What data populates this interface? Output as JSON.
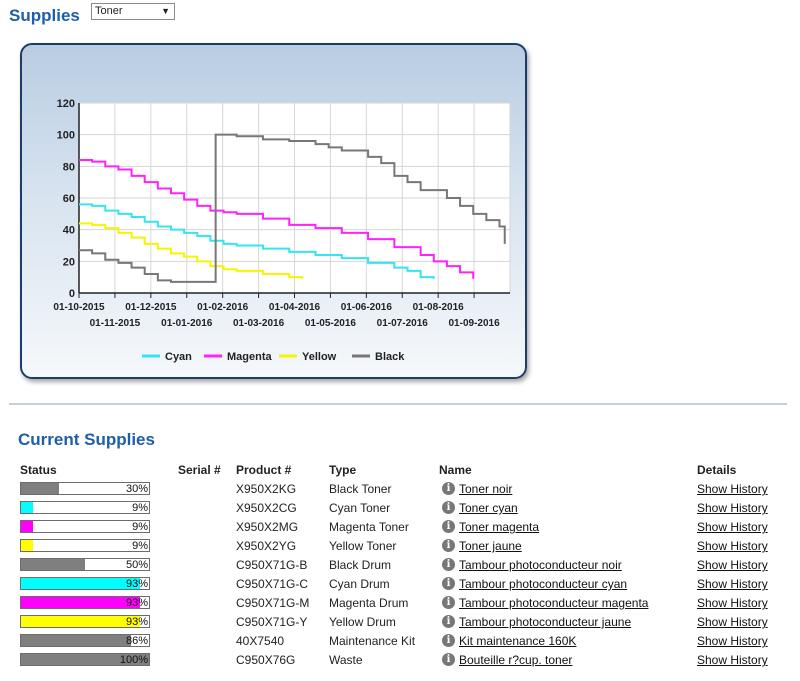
{
  "header": {
    "title": "Supplies",
    "select_value": "Toner"
  },
  "chart_data": {
    "type": "line",
    "x_ticks_top": [
      "01-10-2015",
      "01-12-2015",
      "01-02-2016",
      "01-04-2016",
      "01-06-2016",
      "01-08-2016"
    ],
    "x_ticks_bottom": [
      "01-11-2015",
      "01-01-2016",
      "01-03-2016",
      "01-05-2016",
      "01-07-2016",
      "01-09-2016"
    ],
    "ylim": [
      0,
      120
    ],
    "yticks": [
      "0",
      "20",
      "40",
      "60",
      "80",
      "100",
      "120"
    ],
    "grid": true,
    "legend_position": "bottom",
    "series": [
      {
        "name": "Cyan",
        "color": "#33e6ee",
        "points": [
          [
            0,
            56
          ],
          [
            0.5,
            55
          ],
          [
            1,
            52
          ],
          [
            1.5,
            50
          ],
          [
            2,
            48
          ],
          [
            2.5,
            45
          ],
          [
            3,
            42
          ],
          [
            3.5,
            40
          ],
          [
            4,
            38
          ],
          [
            4.5,
            36
          ],
          [
            5,
            33
          ],
          [
            5.5,
            31
          ],
          [
            6,
            30
          ],
          [
            7,
            28
          ],
          [
            8,
            26
          ],
          [
            9,
            24
          ],
          [
            10,
            22
          ],
          [
            11,
            19
          ],
          [
            12,
            16
          ],
          [
            12.5,
            14
          ],
          [
            13,
            10
          ],
          [
            13.5,
            9
          ]
        ]
      },
      {
        "name": "Magenta",
        "color": "#ff22ff",
        "points": [
          [
            0,
            84
          ],
          [
            0.5,
            83
          ],
          [
            1,
            80
          ],
          [
            1.5,
            78
          ],
          [
            2,
            74
          ],
          [
            2.5,
            70
          ],
          [
            3,
            66
          ],
          [
            3.5,
            63
          ],
          [
            4,
            59
          ],
          [
            4.5,
            55
          ],
          [
            5,
            52
          ],
          [
            5.5,
            51
          ],
          [
            6,
            50
          ],
          [
            7,
            47
          ],
          [
            8,
            43
          ],
          [
            9,
            41
          ],
          [
            10,
            38
          ],
          [
            11,
            34
          ],
          [
            12,
            29
          ],
          [
            13,
            24
          ],
          [
            13.5,
            20
          ],
          [
            14,
            17
          ],
          [
            14.5,
            13
          ],
          [
            15,
            9
          ]
        ]
      },
      {
        "name": "Yellow",
        "color": "#f5f500",
        "points": [
          [
            0,
            44
          ],
          [
            0.5,
            43
          ],
          [
            1,
            41
          ],
          [
            1.5,
            38
          ],
          [
            2,
            35
          ],
          [
            2.5,
            31
          ],
          [
            3,
            28
          ],
          [
            3.5,
            25
          ],
          [
            4,
            23
          ],
          [
            4.5,
            20
          ],
          [
            5,
            17
          ],
          [
            5.5,
            15
          ],
          [
            6,
            14
          ],
          [
            7,
            12
          ],
          [
            8,
            10
          ],
          [
            8.5,
            9
          ]
        ]
      },
      {
        "name": "Black",
        "color": "#777777",
        "points": [
          [
            0,
            27
          ],
          [
            0.5,
            25
          ],
          [
            1,
            21
          ],
          [
            1.5,
            19
          ],
          [
            2,
            16
          ],
          [
            2.5,
            12
          ],
          [
            3,
            8
          ],
          [
            3.5,
            7
          ],
          [
            4,
            7
          ],
          [
            5,
            7
          ],
          [
            5.2,
            100
          ],
          [
            6,
            99
          ],
          [
            7,
            97
          ],
          [
            8,
            96
          ],
          [
            9,
            94
          ],
          [
            9.5,
            92
          ],
          [
            10,
            90
          ],
          [
            11,
            86
          ],
          [
            11.5,
            82
          ],
          [
            12,
            74
          ],
          [
            12.5,
            70
          ],
          [
            13,
            65
          ],
          [
            14,
            60
          ],
          [
            14.5,
            55
          ],
          [
            15,
            50
          ],
          [
            15.5,
            46
          ],
          [
            16,
            42
          ],
          [
            16.2,
            31
          ]
        ]
      }
    ],
    "xlim": [
      0,
      16.4
    ]
  },
  "current": {
    "title": "Current Supplies",
    "headers": {
      "status": "Status",
      "serial": "Serial #",
      "product": "Product #",
      "type": "Type",
      "name": "Name",
      "details": "Details"
    },
    "rows": [
      {
        "pct": 30,
        "pct_label": "30%",
        "fill": "#7f7f7f",
        "product": "X950X2KG",
        "type": "Black Toner",
        "name": "Toner noir",
        "details": "Show History"
      },
      {
        "pct": 9,
        "pct_label": "9%",
        "fill": "#00ffff",
        "product": "X950X2CG",
        "type": "Cyan Toner",
        "name": "Toner cyan",
        "details": "Show History"
      },
      {
        "pct": 9,
        "pct_label": "9%",
        "fill": "#ff00ff",
        "product": "X950X2MG",
        "type": "Magenta Toner",
        "name": "Toner magenta",
        "details": "Show History"
      },
      {
        "pct": 9,
        "pct_label": "9%",
        "fill": "#ffff00",
        "product": "X950X2YG",
        "type": "Yellow Toner",
        "name": "Toner jaune",
        "details": "Show History"
      },
      {
        "pct": 50,
        "pct_label": "50%",
        "fill": "#7f7f7f",
        "product": "C950X71G-B",
        "type": "Black Drum",
        "name": "Tambour photoconducteur noir",
        "details": "Show History"
      },
      {
        "pct": 93,
        "pct_label": "93%",
        "fill": "#00ffff",
        "product": "C950X71G-C",
        "type": "Cyan Drum",
        "name": "Tambour photoconducteur cyan",
        "details": "Show History"
      },
      {
        "pct": 93,
        "pct_label": "93%",
        "fill": "#ff00ff",
        "product": "C950X71G-M",
        "type": "Magenta Drum",
        "name": "Tambour photoconducteur magenta",
        "details": "Show History"
      },
      {
        "pct": 93,
        "pct_label": "93%",
        "fill": "#ffff00",
        "product": "C950X71G-Y",
        "type": "Yellow Drum",
        "name": "Tambour photoconducteur jaune",
        "details": "Show History"
      },
      {
        "pct": 86,
        "pct_label": "86%",
        "fill": "#7f7f7f",
        "product": "40X7540",
        "type": "Maintenance Kit",
        "name": "Kit maintenance 160K",
        "details": "Show History"
      },
      {
        "pct": 100,
        "pct_label": "100%",
        "fill": "#7f7f7f",
        "product": "C950X76G",
        "type": "Waste",
        "name": "Bouteille r?cup. toner",
        "details": "Show History"
      }
    ]
  }
}
